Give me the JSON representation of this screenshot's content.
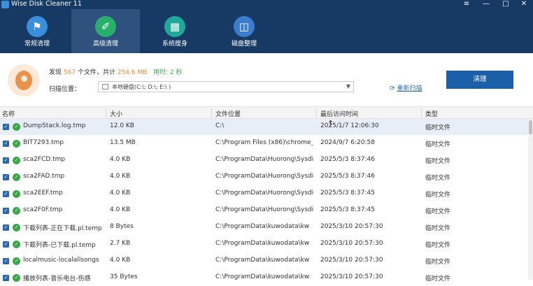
{
  "window": {
    "title": "Wise Disk Cleaner 11",
    "controls": [
      "≡",
      "—",
      "□",
      "✕"
    ]
  },
  "nav": {
    "items": [
      {
        "label": "常规清理",
        "icon": "broom-icon",
        "color": "#3a8edb"
      },
      {
        "label": "高级清理",
        "icon": "advanced-clean-icon",
        "color": "#27b06a"
      },
      {
        "label": "系统瘦身",
        "icon": "windows-icon",
        "color": "#20a89a"
      },
      {
        "label": "磁盘整理",
        "icon": "disk-defrag-icon",
        "color": "#3a7ccf"
      }
    ],
    "active_index": 1
  },
  "summary": {
    "found_prefix": "发现",
    "file_count": "567",
    "file_unit": "个文件，共计",
    "total_size": "254.6 MB",
    "time_label": "用时: 2 秒",
    "scan_location_label": "扫描位置：",
    "scan_location_value": "本地硬盘(C:\\; D:\\; E:\\ )",
    "rescan_label": "重新扫描",
    "clean_button": "清理"
  },
  "table": {
    "columns": [
      "名称",
      "大小",
      "文件位置",
      "最后访问时间",
      "类型"
    ],
    "rows": [
      {
        "name": "DumpStack.log.tmp",
        "size": "12.0 KB",
        "location": "C:\\",
        "time": "2025/1/7 12:06:30",
        "type": "临时文件"
      },
      {
        "name": "BIT7293.tmp",
        "size": "13.5 MB",
        "location": "C:\\Program Files (x86)\\chrome_",
        "time": "2024/9/7 6:20:58",
        "type": "临时文件"
      },
      {
        "name": "sca2FCD.tmp",
        "size": "4.0 KB",
        "location": "C:\\ProgramData\\Huorong\\Sysdi",
        "time": "2025/5/3 8:37:46",
        "type": "临时文件"
      },
      {
        "name": "sca2FAD.tmp",
        "size": "4.0 KB",
        "location": "C:\\ProgramData\\Huorong\\Sysdi",
        "time": "2025/5/3 8:37:46",
        "type": "临时文件"
      },
      {
        "name": "sca2EEF.tmp",
        "size": "4.0 KB",
        "location": "C:\\ProgramData\\Huorong\\Sysdi",
        "time": "2025/5/3 8:37:45",
        "type": "临时文件"
      },
      {
        "name": "sca2F0F.tmp",
        "size": "4.0 KB",
        "location": "C:\\ProgramData\\Huorong\\Sysdi",
        "time": "2025/5/3 8:37:45",
        "type": "临时文件"
      },
      {
        "name": "下载列表-正在下载.pl.temp",
        "size": "8 Bytes",
        "location": "C:\\ProgramData\\kuwodata\\kw",
        "time": "2025/3/10 20:57:30",
        "type": "临时文件"
      },
      {
        "name": "下载列表-已下载.pl.temp",
        "size": "2.7 KB",
        "location": "C:\\ProgramData\\kuwodata\\kw",
        "time": "2025/3/10 20:57:30",
        "type": "临时文件"
      },
      {
        "name": "localmusic-localallsongs",
        "size": "4.0 KB",
        "location": "C:\\ProgramData\\kuwodata\\kw",
        "time": "2025/3/10 20:57:30",
        "type": "临时文件"
      },
      {
        "name": "播放列表-音乐电台-伤感",
        "size": "35 Bytes",
        "location": "C:\\ProgramData\\kuwodata\\kw",
        "time": "2025/3/10 20:57:30",
        "type": "临时文件"
      }
    ]
  }
}
